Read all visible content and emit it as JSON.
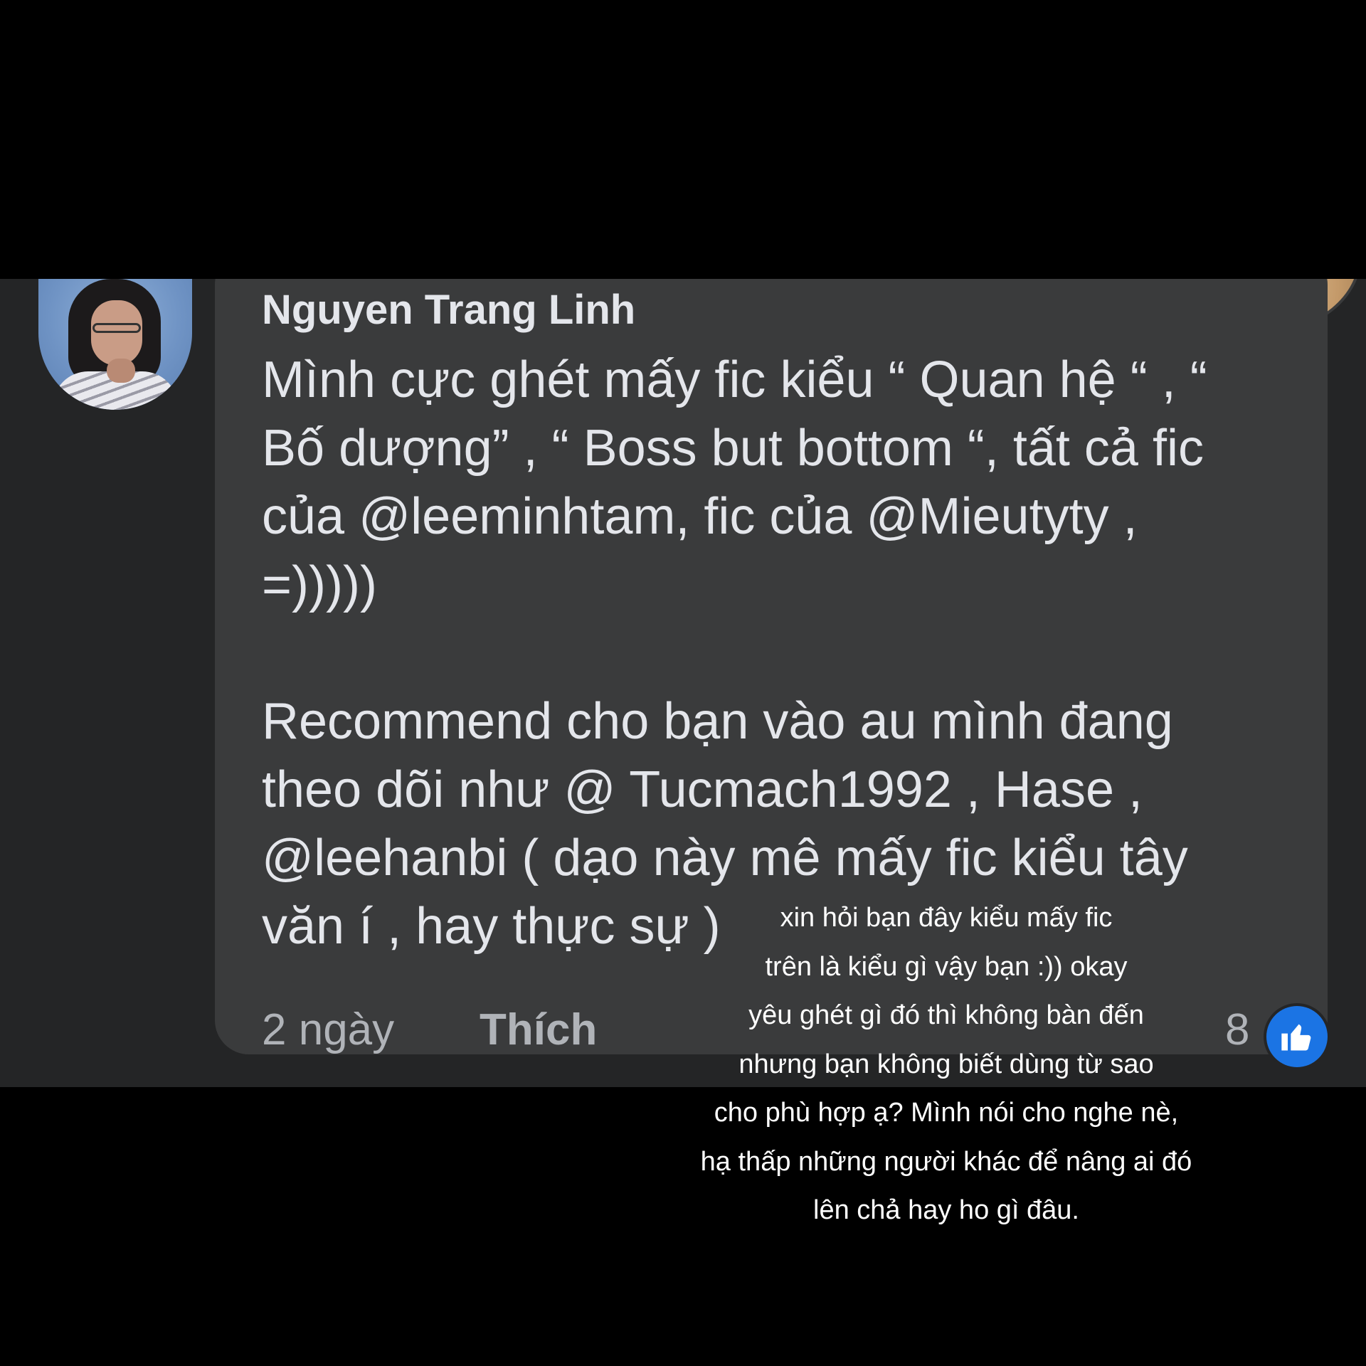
{
  "comment": {
    "author": "Nguyen Trang Linh",
    "text": "Mình cực ghét mấy fic kiểu “ Quan hệ “ , “\nBố dượng” , “ Boss but bottom “, tất cả fic\ncủa @leeminhtam, fic của @Mieutyty ,\n=)))))\n\nRecommend cho bạn vào au mình đang\ntheo dõi như @ Tucmach1992 , Hase ,\n@leehanbi ( dạo này mê mấy fic kiểu tây\nvăn í , hay thực sự )",
    "time": "2 ngày",
    "like_label": "Thích",
    "reaction_count": "8",
    "reaction_icon": "thumbs-up-icon",
    "reaction_color": "#1b74e4"
  },
  "caption": {
    "text": "xin hỏi bạn đây kiểu mấy fic\ntrên là kiểu gì vậy bạn :)) okay\nyêu ghét gì đó thì không bàn đến\nnhưng bạn không biết dùng từ sao\ncho phù hợp ạ? Mình nói cho nghe nè,\nhạ thấp những người khác để nâng ai đó\nlên chả hay ho gì đâu."
  }
}
